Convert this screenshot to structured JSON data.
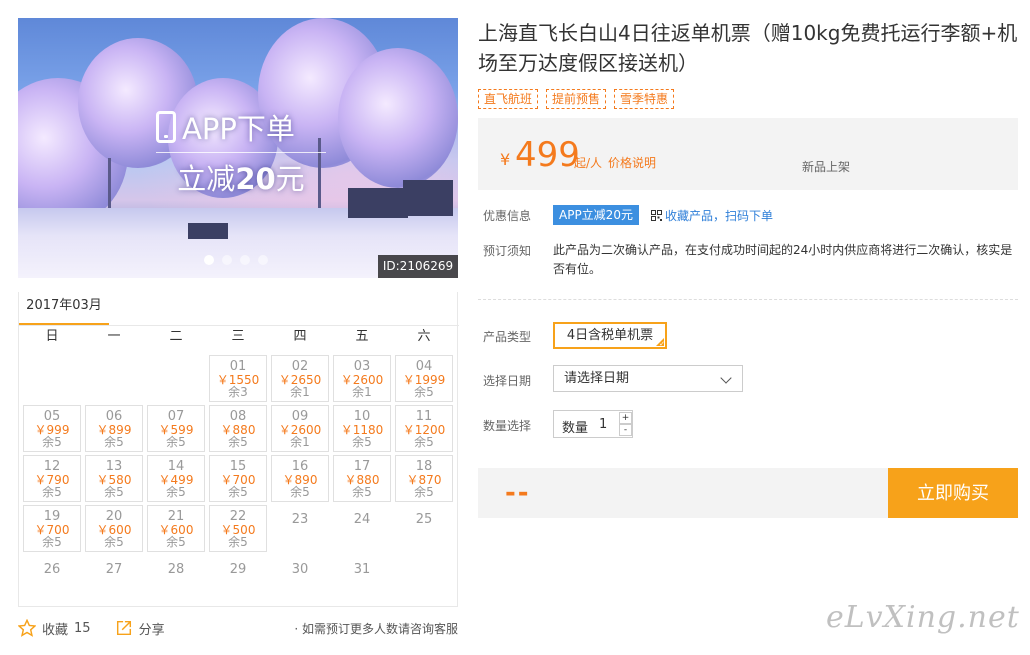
{
  "hero": {
    "promo_line1": "APP下单",
    "promo_line2_prefix": "立减",
    "promo_line2_amount": "20",
    "promo_line2_suffix": "元",
    "product_id": "ID:2106269",
    "slide_count": 4,
    "active_slide": 1
  },
  "calendar": {
    "month": "2017年03月",
    "weekdays": [
      "日",
      "一",
      "二",
      "三",
      "四",
      "五",
      "六"
    ],
    "days": [
      {
        "date": "",
        "price": "",
        "stock": ""
      },
      {
        "date": "",
        "price": "",
        "stock": ""
      },
      {
        "date": "",
        "price": "",
        "stock": ""
      },
      {
        "date": "01",
        "price": "￥1550",
        "stock": "余3"
      },
      {
        "date": "02",
        "price": "￥2650",
        "stock": "余1"
      },
      {
        "date": "03",
        "price": "￥2600",
        "stock": "余1"
      },
      {
        "date": "04",
        "price": "￥1999",
        "stock": "余5"
      },
      {
        "date": "05",
        "price": "￥999",
        "stock": "余5"
      },
      {
        "date": "06",
        "price": "￥899",
        "stock": "余5"
      },
      {
        "date": "07",
        "price": "￥599",
        "stock": "余5"
      },
      {
        "date": "08",
        "price": "￥880",
        "stock": "余5"
      },
      {
        "date": "09",
        "price": "￥2600",
        "stock": "余1"
      },
      {
        "date": "10",
        "price": "￥1180",
        "stock": "余5"
      },
      {
        "date": "11",
        "price": "￥1200",
        "stock": "余5"
      },
      {
        "date": "12",
        "price": "￥790",
        "stock": "余5"
      },
      {
        "date": "13",
        "price": "￥580",
        "stock": "余5"
      },
      {
        "date": "14",
        "price": "￥499",
        "stock": "余5"
      },
      {
        "date": "15",
        "price": "￥700",
        "stock": "余5"
      },
      {
        "date": "16",
        "price": "￥890",
        "stock": "余5"
      },
      {
        "date": "17",
        "price": "￥880",
        "stock": "余5"
      },
      {
        "date": "18",
        "price": "￥870",
        "stock": "余5"
      },
      {
        "date": "19",
        "price": "￥700",
        "stock": "余5"
      },
      {
        "date": "20",
        "price": "￥600",
        "stock": "余5"
      },
      {
        "date": "21",
        "price": "￥600",
        "stock": "余5"
      },
      {
        "date": "22",
        "price": "￥500",
        "stock": "余5"
      },
      {
        "date": "23",
        "price": "",
        "stock": ""
      },
      {
        "date": "24",
        "price": "",
        "stock": ""
      },
      {
        "date": "25",
        "price": "",
        "stock": ""
      },
      {
        "date": "26",
        "price": "",
        "stock": ""
      },
      {
        "date": "27",
        "price": "",
        "stock": ""
      },
      {
        "date": "28",
        "price": "",
        "stock": ""
      },
      {
        "date": "29",
        "price": "",
        "stock": ""
      },
      {
        "date": "30",
        "price": "",
        "stock": ""
      },
      {
        "date": "31",
        "price": "",
        "stock": ""
      }
    ]
  },
  "actions": {
    "favorite_label": "收藏",
    "favorite_count": "15",
    "share_label": "分享",
    "consult_text": "· 如需预订更多人数请咨询客服"
  },
  "product": {
    "title": "上海直飞长白山4日往返单机票（赠10kg免费托运行李额+机场至万达度假区接送机）",
    "tags": [
      "直飞航班",
      "提前预售",
      "雪季特惠"
    ],
    "price": {
      "currency": "¥",
      "amount": "499",
      "unit": "起/人",
      "explain_link": "价格说明",
      "new_label": "新品上架"
    },
    "promo": {
      "label": "优惠信息",
      "badge": "APP立减20元",
      "qr_link": "收藏产品，扫码下单"
    },
    "notice": {
      "label": "预订须知",
      "text": "此产品为二次确认产品，在支付成功时间起的24小时内供应商将进行二次确认，核实是否有位。"
    },
    "type": {
      "label": "产品类型",
      "selected": "4日含税单机票"
    },
    "date": {
      "label": "选择日期",
      "value": "请选择日期"
    },
    "quantity": {
      "label": "数量选择",
      "inner_label": "数量",
      "value": "1",
      "plus": "+",
      "minus": "-"
    },
    "total": "--",
    "buy_button": "立即购买"
  },
  "watermark": "eLvXing.net",
  "colors": {
    "accent_orange": "#f47a1d",
    "button_orange": "#f7a21a",
    "promo_blue": "#3c8fe0",
    "link_blue": "#2f7fd8"
  }
}
